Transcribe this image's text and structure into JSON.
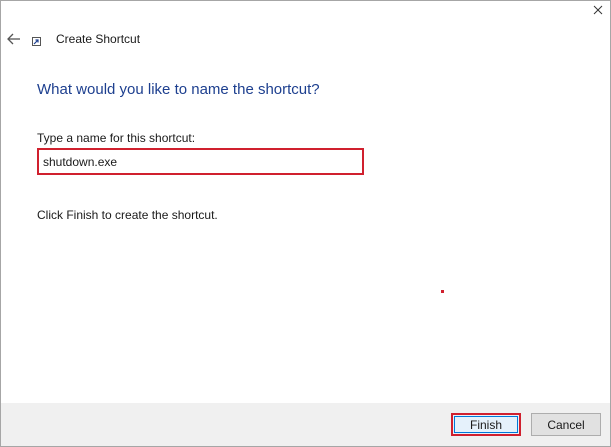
{
  "window": {
    "title": "Create Shortcut",
    "close_icon": "close-icon",
    "back_icon": "back-arrow-icon",
    "app_icon": "shortcut-icon"
  },
  "main": {
    "heading": "What would you like to name the shortcut?",
    "name_label": "Type a name for this shortcut:",
    "name_value": "shutdown.exe",
    "instruction": "Click Finish to create the shortcut."
  },
  "footer": {
    "finish_label": "Finish",
    "cancel_label": "Cancel"
  },
  "colors": {
    "heading": "#1d3f8f",
    "highlight": "#d0202e",
    "footer_bg": "#f0f0f0"
  }
}
